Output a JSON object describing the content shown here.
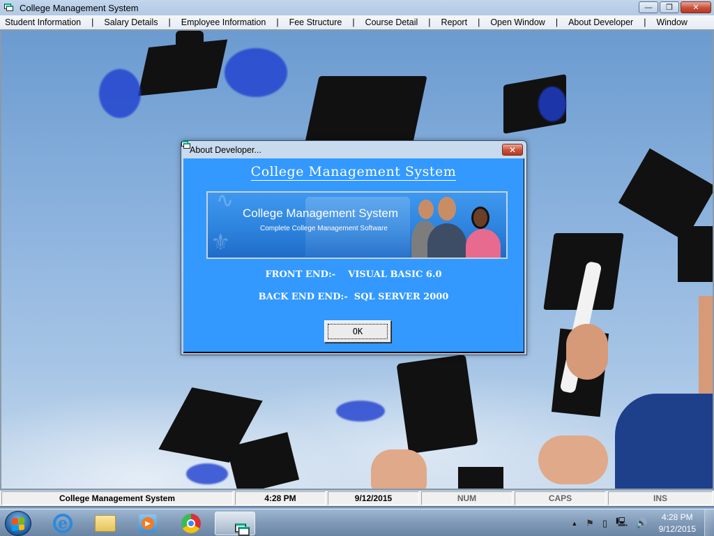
{
  "window": {
    "title": "College Management System",
    "controls": {
      "minimize": "—",
      "restore": "❐",
      "close": "✕"
    }
  },
  "menu": {
    "items": [
      "Student Information",
      "Salary Details",
      "Employee Information",
      "Fee Structure",
      "Course Detail",
      "Report",
      "Open Window",
      "About Developer",
      "Window"
    ],
    "separator": "|"
  },
  "dialog": {
    "title": "About Developer...",
    "close": "✕",
    "heading": "College Management System",
    "banner": {
      "title": "College Management System",
      "subtitle": "Complete College Management Software"
    },
    "front_end": "FRONT END:-    VISUAL BASIC 6.0",
    "back_end": "BACK END END:-  SQL SERVER 2000",
    "ok_label": "OK"
  },
  "statusbar": {
    "panels": [
      {
        "text": "College Management System",
        "dim": false
      },
      {
        "text": "4:28 PM",
        "dim": false
      },
      {
        "text": "9/12/2015",
        "dim": false
      },
      {
        "text": "NUM",
        "dim": true
      },
      {
        "text": "CAPS",
        "dim": true
      },
      {
        "text": "INS",
        "dim": true
      }
    ]
  },
  "taskbar": {
    "pinned": [
      "start-button",
      "internet-explorer",
      "windows-explorer",
      "windows-media-player",
      "google-chrome",
      "college-management-system"
    ],
    "tray": {
      "show_hidden": "▲",
      "action_center": "⚑",
      "battery": "▯",
      "network": "🖳",
      "volume": "🔊",
      "time": "4:28 PM",
      "date": "9/12/2015"
    }
  }
}
